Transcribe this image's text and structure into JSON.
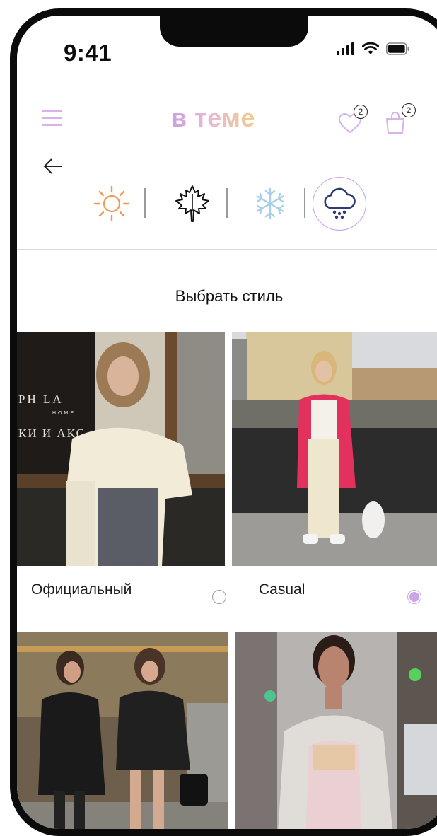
{
  "status_bar": {
    "time": "9:41"
  },
  "header": {
    "logo": "в теме",
    "favorites_count": "2",
    "cart_count": "2"
  },
  "seasons": {
    "items": [
      "sun-icon",
      "maple-leaf-icon",
      "snowflake-icon",
      "rain-cloud-icon"
    ],
    "selected": "rain-cloud-icon"
  },
  "section_title": "Выбрать стиль",
  "styles": [
    {
      "label": "Официальный",
      "selected": false
    },
    {
      "label": "Casual",
      "selected": true
    }
  ],
  "colors": {
    "accent": "#c9a6e8",
    "sun": "#f0994f",
    "snow": "#a7cfe8",
    "rain": "#2f3b73",
    "logo_start": "#caa0dd",
    "logo_end": "#f1cc8c"
  }
}
